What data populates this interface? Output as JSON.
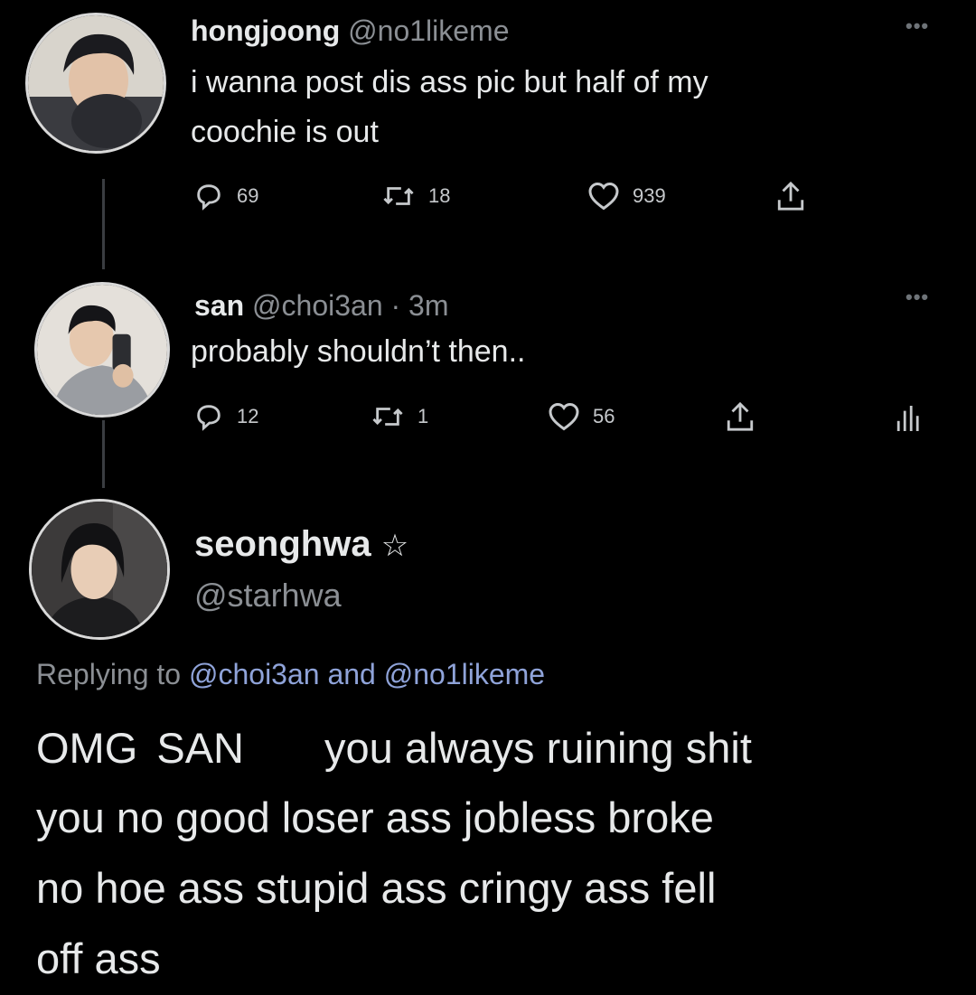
{
  "tweets": [
    {
      "name": "hongjoong",
      "handle": "@no1likeme",
      "text_line1": "i wanna post dis ass pic but half of my",
      "text_line2": "coochie is out",
      "replies": "69",
      "retweets": "18",
      "likes": "939"
    },
    {
      "name": "san",
      "handle": "@choi3an",
      "time": "· 3m",
      "text_line1": "probably shouldn’t then..",
      "replies": "12",
      "retweets": "1",
      "likes": "56"
    },
    {
      "name": "seonghwa",
      "name_badge": "☆",
      "handle": "@starhwa",
      "replying_prefix": "Replying to",
      "replying_user1": "@choi3an",
      "replying_and": "and",
      "replying_user2": "@no1likeme",
      "text_line1_a": "OMG",
      "text_line1_b": "SAN",
      "text_line1_c": "you always ruining shit",
      "text_line2": "you no good loser ass jobless broke",
      "text_line3": "no hoe ass stupid ass cringy ass fell",
      "text_line4": "off ass"
    }
  ],
  "colors": {
    "background": "#000000",
    "text": "#e7e9ea",
    "muted": "#8b8f94",
    "link": "#8fa3d9"
  },
  "icons": [
    "reply-icon",
    "retweet-icon",
    "like-icon",
    "share-icon",
    "analytics-icon",
    "more-icon"
  ]
}
